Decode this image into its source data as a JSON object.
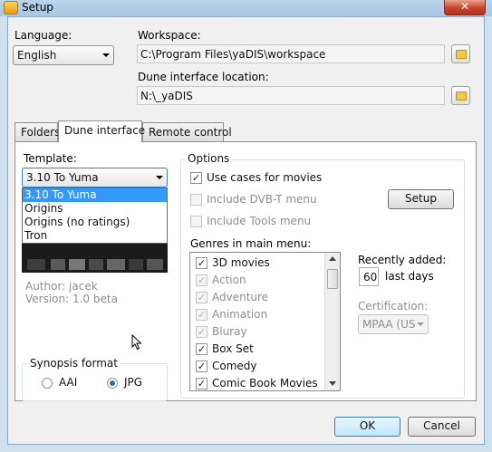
{
  "window": {
    "title": "Setup",
    "close_glyph": "✕"
  },
  "language": {
    "label": "Language:",
    "value": "English"
  },
  "workspace": {
    "label": "Workspace:",
    "value": "C:\\Program Files\\yaDIS\\workspace"
  },
  "dune_location": {
    "label": "Dune interface location:",
    "value": "N:\\_yaDIS"
  },
  "tabs": [
    {
      "label": "Folders"
    },
    {
      "label": "Dune interface"
    },
    {
      "label": "Remote control"
    }
  ],
  "template": {
    "label": "Template:",
    "selected": "3.10 To Yuma",
    "options": [
      "3.10 To Yuma",
      "Origins",
      "Origins (no ratings)",
      "Tron"
    ],
    "author": "Author: jacek",
    "version": "Version: 1.0 beta"
  },
  "synopsis": {
    "title": "Synopsis format",
    "options": [
      {
        "label": "AAI",
        "checked": false
      },
      {
        "label": "JPG",
        "checked": true
      }
    ]
  },
  "options": {
    "title": "Options",
    "use_cases": {
      "label": "Use cases for movies",
      "checked": true
    },
    "dvbt": {
      "label": "Include DVB-T menu",
      "checked": false
    },
    "tools": {
      "label": "Include Tools menu",
      "checked": false
    },
    "setup_button": "Setup",
    "genres_label": "Genres in main menu:",
    "genres": [
      {
        "label": "3D movies",
        "checked": true,
        "enabled": true
      },
      {
        "label": "Action",
        "checked": true,
        "enabled": false
      },
      {
        "label": "Adventure",
        "checked": true,
        "enabled": false
      },
      {
        "label": "Animation",
        "checked": true,
        "enabled": false
      },
      {
        "label": "Bluray",
        "checked": true,
        "enabled": false
      },
      {
        "label": "Box Set",
        "checked": true,
        "enabled": true
      },
      {
        "label": "Comedy",
        "checked": true,
        "enabled": true
      },
      {
        "label": "Comic Book Movies",
        "checked": true,
        "enabled": true
      }
    ],
    "recently_added": {
      "label": "Recently added:",
      "value": "60",
      "suffix": "last days"
    },
    "certification": {
      "label": "Certification:",
      "value": "MPAA (US"
    }
  },
  "buttons": {
    "ok": "OK",
    "cancel": "Cancel"
  },
  "icons": {
    "check": "✓",
    "folder": "folder-icon",
    "cursor": "mouse-cursor-icon"
  }
}
